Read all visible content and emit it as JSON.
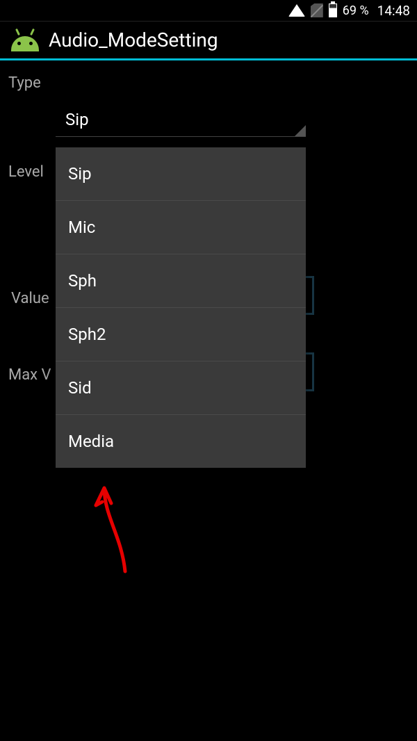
{
  "status_bar": {
    "battery_pct": "69 %",
    "time": "14:48"
  },
  "title": "Audio_ModeSetting",
  "labels": {
    "type": "Type",
    "level": "Level",
    "value": "Value",
    "max": "Max V"
  },
  "spinner_selected": "Sip",
  "dropdown": {
    "items": [
      {
        "label": "Sip"
      },
      {
        "label": "Mic"
      },
      {
        "label": "Sph"
      },
      {
        "label": "Sph2"
      },
      {
        "label": "Sid"
      },
      {
        "label": "Media"
      }
    ]
  },
  "colors": {
    "accent": "#00bcd4",
    "annotation": "#e60000"
  }
}
